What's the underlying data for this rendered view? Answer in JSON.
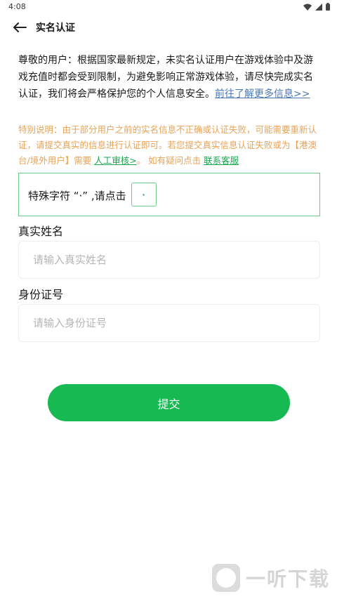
{
  "status_bar": {
    "time": "4:08",
    "icons": [
      "wifi-icon",
      "signal-icon",
      "battery-icon"
    ]
  },
  "app_bar": {
    "back_icon": "arrow-left-icon",
    "title": "实名认证"
  },
  "notice": {
    "text": "尊敬的用户：根据国家最新规定，未实名认证用户在游戏体验中及游戏充值时都会受到限制，为避免影响正常游戏体验，请尽快完成实名认证，我们将会严格保护您的个人信息安全。",
    "link": "前往了解更多信息>>"
  },
  "special_notice": {
    "text_before": "特别说明：由于部分用户之前的实名信息不正确或认证失败，可能需要重新认证，请提交真实的信息进行认证即可。若您提交真实信息认证失败或为【港澳台/境外用户】需要",
    "manual_link": "人工审核>",
    "text_mid": "。 如有疑问点击",
    "service_link": "联系客服"
  },
  "special_char": {
    "label": "特殊字符 “·” ,请点击",
    "button": "·"
  },
  "form": {
    "name_label": "真实姓名",
    "name_placeholder": "请输入真实姓名",
    "id_label": "身份证号",
    "id_placeholder": "请输入身份证号"
  },
  "submit_label": "提交",
  "watermark": {
    "logo_text": "听",
    "text": "一听下载"
  },
  "colors": {
    "primary": "#17b953",
    "warning": "#e8a356",
    "link": "#4a78b5",
    "border": "#6fc88a"
  }
}
